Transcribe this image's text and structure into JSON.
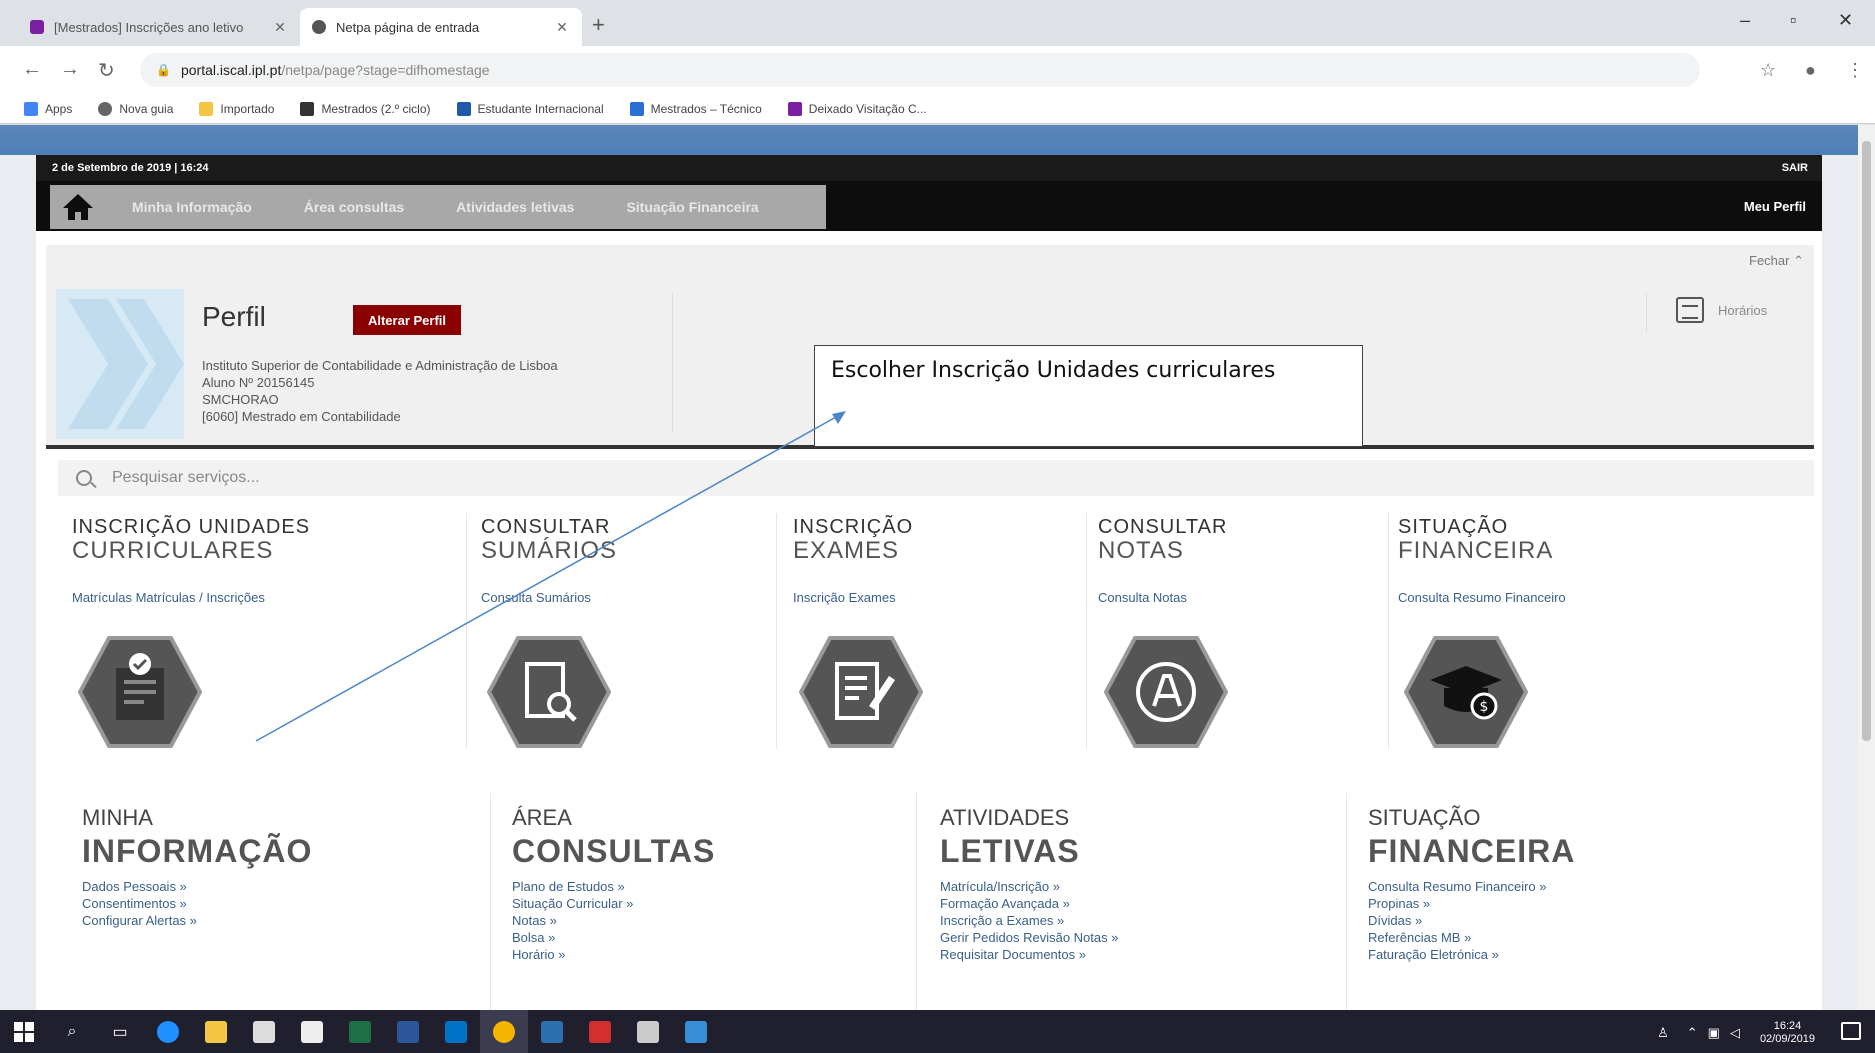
{
  "browser": {
    "tabs": [
      {
        "title": "[Mestrados] Inscrições ano letivo",
        "active": false
      },
      {
        "title": "Netpa página de entrada",
        "active": true
      }
    ],
    "url_host": "portal.iscal.ipl.pt",
    "url_path": "/netpa/page?stage=difhomestage",
    "bookmarks": [
      "Apps",
      "Nova guia",
      "Importado",
      "Mestrados (2.º ciclo)",
      "Estudante Internacional",
      "Mestrados – Técnico",
      "Deixado Visitação C..."
    ]
  },
  "portal": {
    "datetime": "2 de Setembro de 2019 | 16:24",
    "sair": "SAIR",
    "menu": [
      "Minha Informação",
      "Área consultas",
      "Atividades letivas",
      "Situação Financeira"
    ],
    "meu_perfil": "Meu Perfil",
    "fechar": "Fechar",
    "profile": {
      "title": "Perfil",
      "alterar": "Alterar Perfil",
      "institution": "Instituto Superior de Contabilidade e Administração de Lisboa",
      "aluno": "Aluno Nº 20156145",
      "name": "SMCHORAO",
      "course": "[6060] Mestrado em Contabilidade"
    },
    "horarios": "Horários",
    "search_placeholder": "Pesquisar serviços...",
    "services": [
      {
        "h1": "INSCRIÇÃO UNIDADES",
        "h2": "CURRICULARES",
        "link": "Matrículas Matrículas / Inscrições"
      },
      {
        "h1": "CONSULTAR",
        "h2": "SUMÁRIOS",
        "link": "Consulta Sumários"
      },
      {
        "h1": "INSCRIÇÃO",
        "h2": "EXAMES",
        "link": "Inscrição Exames"
      },
      {
        "h1": "CONSULTAR",
        "h2": "NOTAS",
        "link": "Consulta Notas"
      },
      {
        "h1": "SITUAÇÃO",
        "h2": "FINANCEIRA",
        "link": "Consulta Resumo Financeiro"
      }
    ],
    "categories": [
      {
        "c1": "MINHA",
        "c2": "INFORMAÇÃO",
        "links": [
          "Dados Pessoais »",
          "Consentimentos »",
          "Configurar Alertas »"
        ]
      },
      {
        "c1": "ÁREA",
        "c2": "CONSULTAS",
        "links": [
          "Plano de Estudos »",
          "Situação Curricular »",
          "Notas »",
          "Bolsa »",
          "Horário »"
        ]
      },
      {
        "c1": "ATIVIDADES",
        "c2": "LETIVAS",
        "links": [
          "Matrícula/Inscrição »",
          "Formação Avançada »",
          "Inscrição a Exames »",
          "Gerir Pedidos Revisão Notas »",
          "Requisitar Documentos »"
        ]
      },
      {
        "c1": "SITUAÇÃO",
        "c2": "FINANCEIRA",
        "links": [
          "Consulta Resumo Financeiro »",
          "Propinas »",
          "Dívidas »",
          "Referências MB »",
          "Faturação Eletrónica »"
        ]
      }
    ]
  },
  "annotation": {
    "text": "Escolher Inscrição Unidades curriculares"
  },
  "taskbar": {
    "time": "16:24",
    "date": "02/09/2019"
  },
  "colors": {
    "alterar": "#8b0000",
    "topbar": "#0d0d0d",
    "menu_grey": "#a8a8a8",
    "link": "#3a5f8a"
  }
}
